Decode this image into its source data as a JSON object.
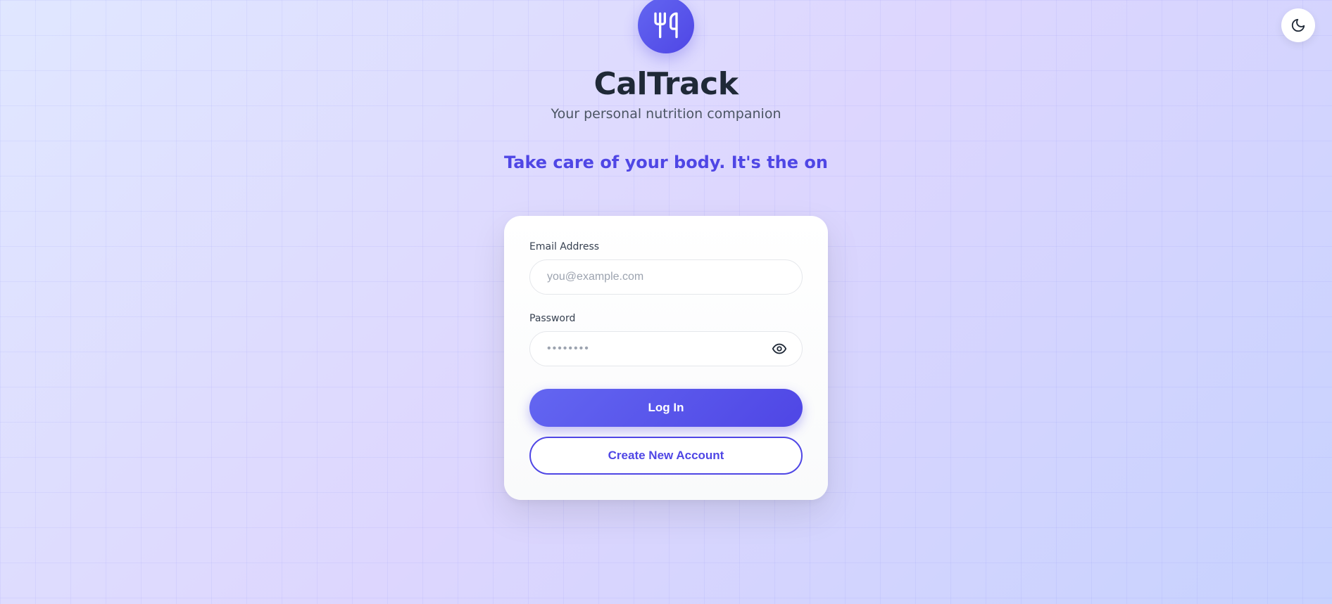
{
  "app": {
    "title": "CalTrack",
    "subtitle": "Your personal nutrition companion"
  },
  "marquee": {
    "text": "Take care of your body. It's the only place you have to live. • The groundwork of all happiness is health. • "
  },
  "form": {
    "email": {
      "label": "Email Address",
      "placeholder": "you@example.com",
      "value": ""
    },
    "password": {
      "label": "Password",
      "placeholder": "••••••••",
      "value": ""
    },
    "login_button": "Log In",
    "create_account_button": "Create New Account"
  },
  "colors": {
    "primary": "#4f46e5",
    "primary_light": "#6366f1",
    "text_dark": "#1f2937",
    "text_muted": "#4b5563"
  }
}
